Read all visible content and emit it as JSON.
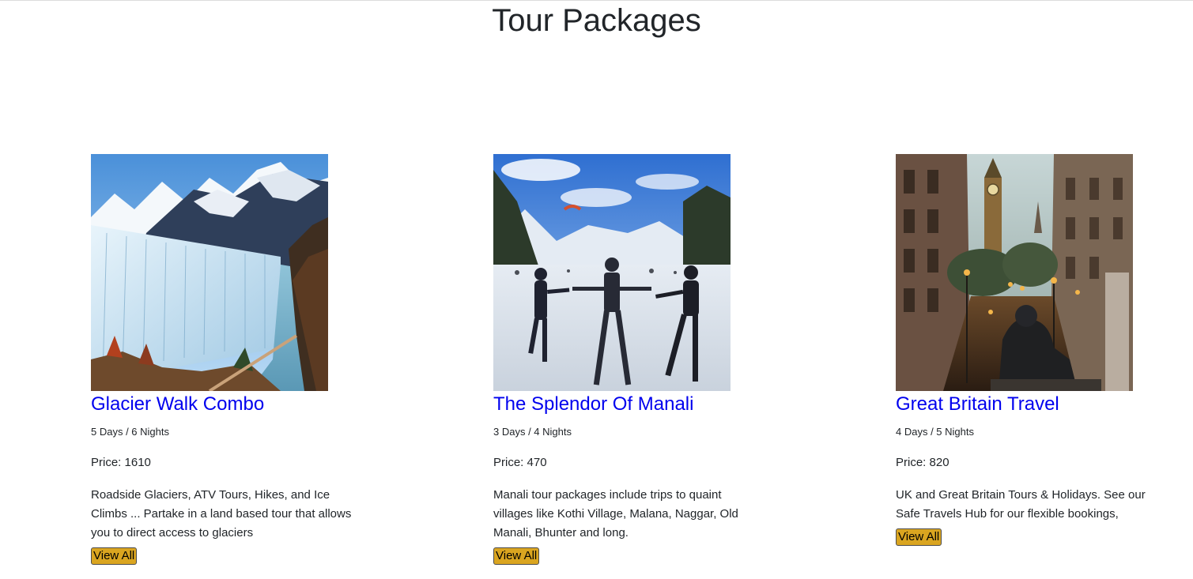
{
  "page": {
    "title": "Tour Packages"
  },
  "colors": {
    "title_link": "#0000ee",
    "button_bg": "#daa520",
    "text": "#212529"
  },
  "packages": [
    {
      "image_subject": "glacier-photo",
      "name": "Glacier Walk Combo",
      "duration": "5 Days / 6 Nights",
      "price": "Price: 1610",
      "description": "Roadside Glaciers, ATV Tours, Hikes, and Ice Climbs ... Partake in a land based tour that allows you to direct access to glaciers",
      "button_label": "View All"
    },
    {
      "image_subject": "manali-snow-photo",
      "name": "The Splendor Of Manali",
      "duration": "3 Days / 4 Nights",
      "price": "Price: 470",
      "description": "Manali tour packages include trips to quaint villages like Kothi Village, Malana, Naggar, Old Manali, Bhunter and long.",
      "button_label": "View All"
    },
    {
      "image_subject": "london-street-photo",
      "name": "Great Britain Travel",
      "duration": "4 Days / 5 Nights",
      "price": "Price: 820",
      "description": "UK and Great Britain Tours & Holidays. See our Safe Travels Hub for our flexible bookings,",
      "button_label": "View All"
    }
  ]
}
